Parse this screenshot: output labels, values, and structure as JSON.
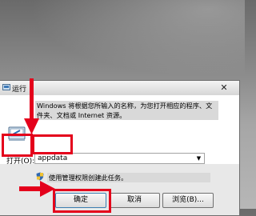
{
  "dialog": {
    "title": "运行",
    "description": "Windows 将根据您所输入的名称，为您打开相应的程序、文件夹、文档或 Internet 资源。",
    "open_label": "打开(O):",
    "input_value": "appdata",
    "admin_note": "使用管理权限创建此任务。",
    "buttons": {
      "ok": "确定",
      "cancel": "取消",
      "browse": "浏览(B)..."
    },
    "close_glyph": "✕"
  },
  "annotations": {
    "color": "#e4001b"
  },
  "icons": [
    "run-icon",
    "shield-icon",
    "close-icon",
    "dropdown-arrow-icon"
  ]
}
